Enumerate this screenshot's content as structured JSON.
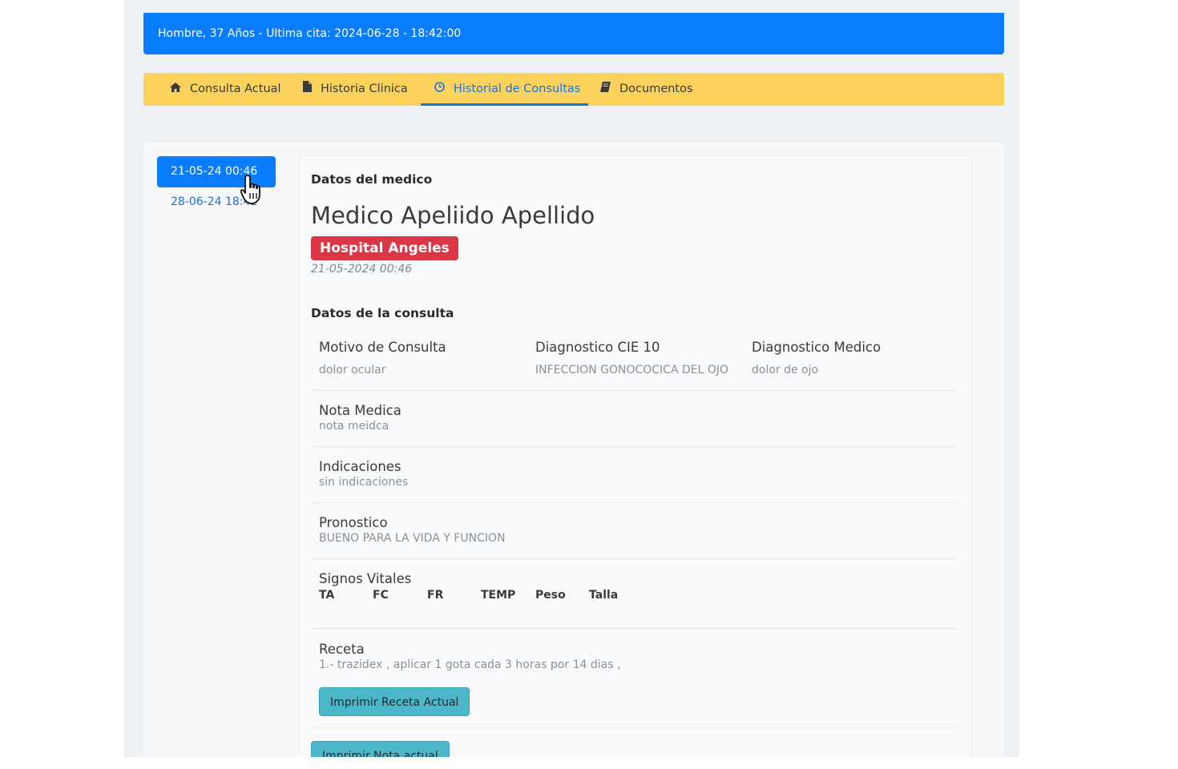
{
  "patient_bar": {
    "text": "Hombre, 37 Años - Ultima cita: 2024-06-28 - 18:42:00"
  },
  "tabs": [
    {
      "label": "Consulta Actual",
      "icon": "home-icon"
    },
    {
      "label": "Historia Clinica",
      "icon": "file-icon"
    },
    {
      "label": "Historial de Consultas",
      "icon": "clock-icon",
      "active": true
    },
    {
      "label": "Documentos",
      "icon": "book-icon"
    }
  ],
  "consult_dates": [
    {
      "label": "21-05-24 00:46",
      "active": true
    },
    {
      "label": "28-06-24 18:42",
      "active": false
    }
  ],
  "doctor": {
    "section_title": "Datos del medico",
    "name": "Medico Apeliido Apellido",
    "hospital": "Hospital Angeles",
    "date": "21-05-2024 00:46"
  },
  "consultation": {
    "section_title": "Datos de la consulta",
    "motivo_label": "Motivo de Consulta",
    "motivo_value": "dolor ocular",
    "cie_label": "Diagnostico CIE 10",
    "cie_value": "INFECCION GONOCOCICA DEL OJO",
    "diag_label": "Diagnostico Medico",
    "diag_value": "dolor de ojo",
    "nota_label": "Nota Medica",
    "nota_value": "nota meidca",
    "indicaciones_label": "Indicaciones",
    "indicaciones_value": "sin indicaciones",
    "pronostico_label": "Pronostico",
    "pronostico_value": "BUENO PARA LA VIDA Y FUNCION",
    "signos_label": "Signos Vitales",
    "vitals_headers": [
      "TA",
      "FC",
      "FR",
      "TEMP",
      "Peso",
      "Talla"
    ],
    "receta_label": "Receta",
    "receta_value": "1.- trazidex , aplicar 1 gota cada 3 horas por 14 dias ,",
    "print_recipe_button": "Imprimir Receta Actual",
    "print_note_button": "Imprimir Nota actual"
  },
  "colors": {
    "primary": "#0a7cff",
    "tab_bar": "#fbd35c",
    "danger": "#dc3545",
    "info": "#4bb7c9"
  }
}
